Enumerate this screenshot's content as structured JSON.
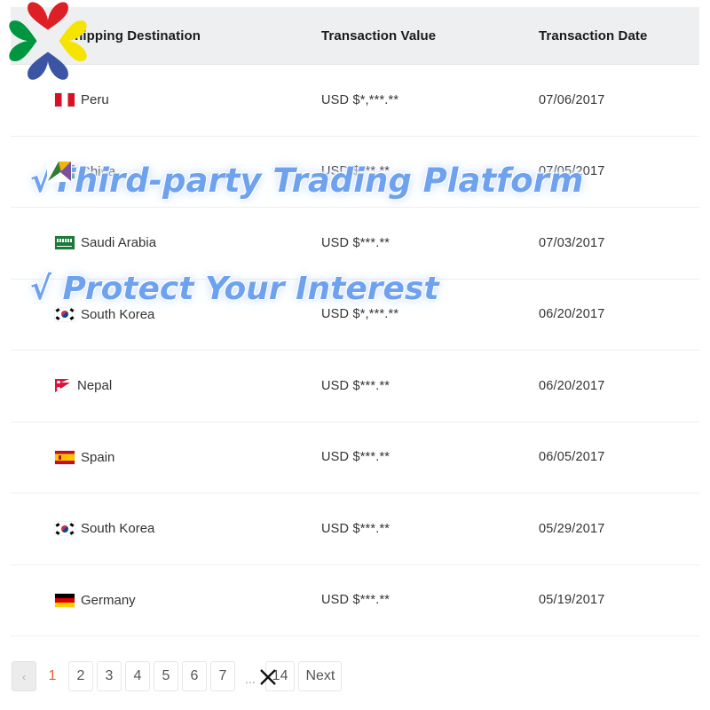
{
  "table": {
    "columns": [
      {
        "key": "destination",
        "label": "Shipping Destination"
      },
      {
        "key": "value",
        "label": "Transaction Value"
      },
      {
        "key": "date",
        "label": "Transaction Date"
      }
    ],
    "rows": [
      {
        "flag": "peru-flag-icon",
        "country": "Peru",
        "value": "USD $*,***.**",
        "date": "07/06/2017"
      },
      {
        "flag": "south-africa-flag-icon",
        "country": "China",
        "value": "USD $***.**",
        "date": "07/05/2017"
      },
      {
        "flag": "saudi-arabia-flag-icon",
        "country": "Saudi Arabia",
        "value": "USD $***.**",
        "date": "07/03/2017"
      },
      {
        "flag": "south-korea-flag-icon",
        "country": "South Korea",
        "value": "USD $*,***.**",
        "date": "06/20/2017"
      },
      {
        "flag": "nepal-flag-icon",
        "country": "Nepal",
        "value": "USD $***.**",
        "date": "06/20/2017"
      },
      {
        "flag": "spain-flag-icon",
        "country": "Spain",
        "value": "USD $***.**",
        "date": "06/05/2017"
      },
      {
        "flag": "south-korea-flag-icon",
        "country": "South Korea",
        "value": "USD $***.**",
        "date": "05/29/2017"
      },
      {
        "flag": "germany-flag-icon",
        "country": "Germany",
        "value": "USD $***.**",
        "date": "05/19/2017"
      }
    ]
  },
  "pagination": {
    "prev_label": "‹",
    "pages": [
      "1",
      "2",
      "3",
      "4",
      "5",
      "6",
      "7"
    ],
    "ellipsis": "...",
    "last_page": "14",
    "next_label": "Next",
    "current_page": "1",
    "active_color": "#ef5b34"
  },
  "watermarks": {
    "line1": "√Third-party Trading Platform",
    "line2": "√ Protect Your Interest",
    "color": "#6ea2ef"
  },
  "logo": {
    "name": "four-hearts-pinwheel-logo",
    "colors": {
      "top": "#dd1f26",
      "right": "#f5e400",
      "bottom": "#3b55a4",
      "left": "#009640"
    }
  },
  "theme": {
    "header_background": "#edeff1",
    "row_border": "#eceef0",
    "text": "#333333"
  }
}
